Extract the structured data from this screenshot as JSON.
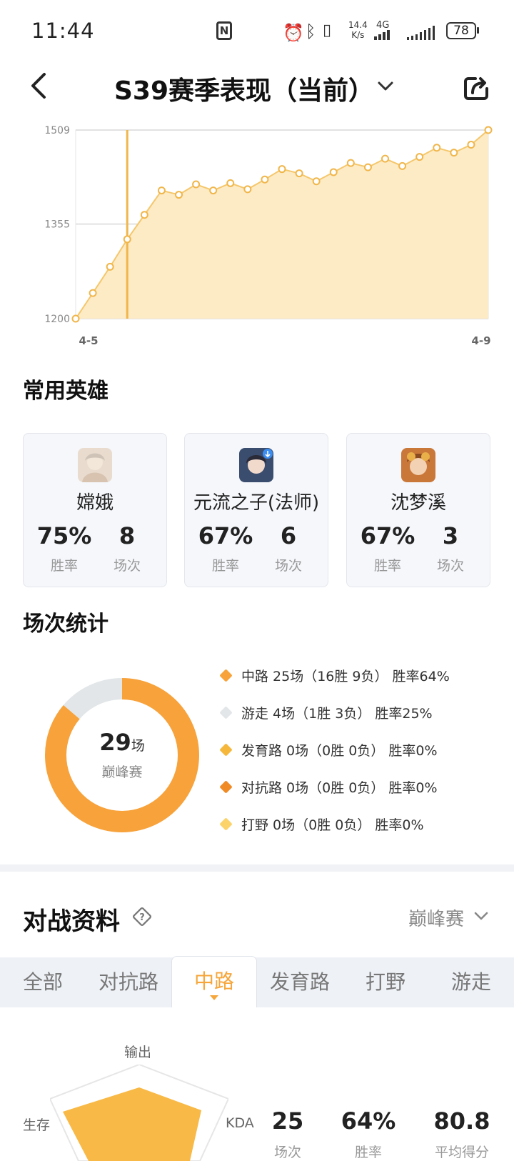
{
  "status_bar": {
    "time": "11:44",
    "nfc": "N",
    "net_speed_top": "14.4",
    "net_speed_bottom": "K/s",
    "network": "4G",
    "battery": "78"
  },
  "header": {
    "title": "S39赛季表现（当前）"
  },
  "chart_data": {
    "type": "area",
    "y_ticks": [
      "1509",
      "1355",
      "1200"
    ],
    "ylim": [
      1200,
      1509
    ],
    "x_labels": [
      "4-5",
      "4-9"
    ],
    "values": [
      1200,
      1242,
      1285,
      1330,
      1370,
      1410,
      1403,
      1420,
      1410,
      1422,
      1412,
      1428,
      1445,
      1438,
      1425,
      1440,
      1455,
      1448,
      1462,
      1450,
      1465,
      1480,
      1472,
      1485,
      1509
    ],
    "highlight_index": 3,
    "colors": {
      "line": "#f5c76b",
      "fill": "#fdebc6",
      "marker": "#f0b64a"
    },
    "grid": true
  },
  "common_heroes": {
    "title": "常用英雄",
    "heroes": [
      {
        "name": "嫦娥",
        "win_rate": "75%",
        "win_rate_label": "胜率",
        "games": "8",
        "games_label": "场次"
      },
      {
        "name": "元流之子(法师)",
        "win_rate": "67%",
        "win_rate_label": "胜率",
        "games": "6",
        "games_label": "场次"
      },
      {
        "name": "沈梦溪",
        "win_rate": "67%",
        "win_rate_label": "胜率",
        "games": "3",
        "games_label": "场次"
      }
    ]
  },
  "match_stats": {
    "title": "场次统计",
    "total": "29",
    "total_unit": "场",
    "mode": "巅峰赛",
    "legend": [
      {
        "text": "中路 25场（16胜 9负） 胜率64%",
        "color": "#f7a23a",
        "games": 25
      },
      {
        "text": "游走 4场（1胜 3负） 胜率25%",
        "color": "#e2e6e8",
        "games": 4
      },
      {
        "text": "发育路 0场（0胜 0负） 胜率0%",
        "color": "#f5b83c",
        "games": 0
      },
      {
        "text": "对抗路 0场（0胜 0负） 胜率0%",
        "color": "#f08a25",
        "games": 0
      },
      {
        "text": "打野 0场（0胜 0负） 胜率0%",
        "color": "#fbd36a",
        "games": 0
      }
    ]
  },
  "battle_data": {
    "title": "对战资料",
    "mode_select": "巅峰赛",
    "tabs": [
      "全部",
      "对抗路",
      "中路",
      "发育路",
      "打野",
      "游走"
    ],
    "active_tab": "中路",
    "radar_labels": {
      "top": "输出",
      "left": "生存",
      "right": "KDA"
    },
    "stats": [
      {
        "value": "25",
        "label": "场次"
      },
      {
        "value": "64%",
        "label": "胜率"
      },
      {
        "value": "80.8",
        "label": "平均得分"
      }
    ]
  }
}
